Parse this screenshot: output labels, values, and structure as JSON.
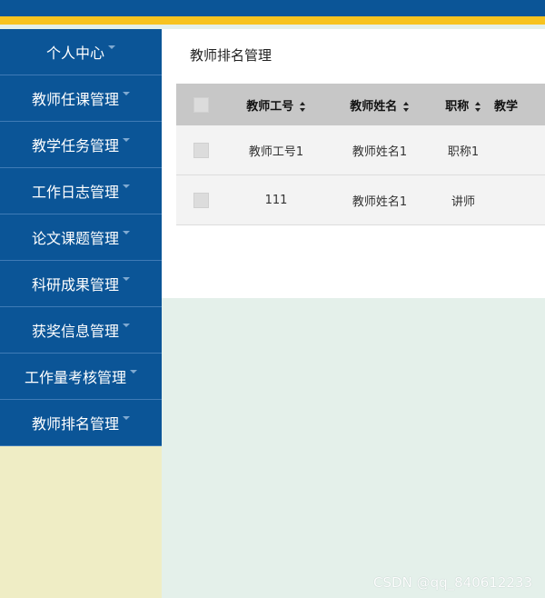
{
  "sidebar": {
    "items": [
      {
        "label": "个人中心"
      },
      {
        "label": "教师任课管理"
      },
      {
        "label": "教学任务管理"
      },
      {
        "label": "工作日志管理"
      },
      {
        "label": "论文课题管理"
      },
      {
        "label": "科研成果管理"
      },
      {
        "label": "获奖信息管理"
      },
      {
        "label": "工作量考核管理"
      },
      {
        "label": "教师排名管理"
      }
    ]
  },
  "main": {
    "title": "教师排名管理",
    "table": {
      "columns": [
        "教师工号",
        "教师姓名",
        "职称",
        "教学"
      ],
      "rows": [
        [
          "教师工号1",
          "教师姓名1",
          "职称1",
          ""
        ],
        [
          "111",
          "教师姓名1",
          "讲师",
          ""
        ]
      ]
    }
  },
  "colors": {
    "topbar": "#0b5597",
    "accent": "#f7c31f",
    "sidebar_bg": "#efedc5",
    "content_bg": "#e4f0ea"
  },
  "watermark": "CSDN @qq_840612233"
}
